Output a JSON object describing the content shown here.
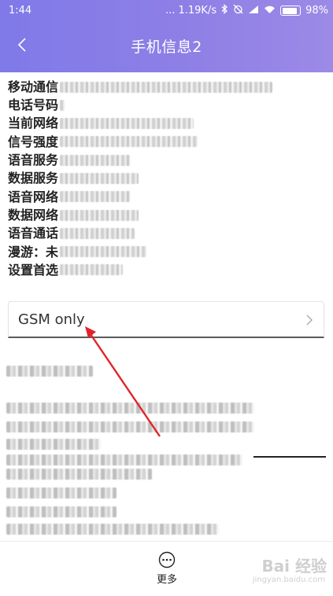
{
  "status_bar": {
    "time": "1:44",
    "network_speed": "... 1.19K/s",
    "battery": "98%"
  },
  "header": {
    "title": "手机信息2"
  },
  "info_rows": [
    {
      "label": "移动通信",
      "blur_width": 270
    },
    {
      "label": "电话号码",
      "blur_width": 6
    },
    {
      "label": "当前网络",
      "blur_width": 170
    },
    {
      "label": "信号强度",
      "blur_width": 175
    },
    {
      "label": "语音服务",
      "blur_width": 90
    },
    {
      "label": "数据服务",
      "blur_width": 100
    },
    {
      "label": "语音网络",
      "blur_width": 90
    },
    {
      "label": "数据网络",
      "blur_width": 100
    },
    {
      "label": "语音通话",
      "blur_width": 95
    },
    {
      "label": "漫游：未",
      "blur_width": 110
    },
    {
      "label": "设置首选",
      "blur_width": 80
    }
  ],
  "preferred_network": {
    "value": "GSM only"
  },
  "bottom_bar": {
    "more_label": "更多"
  },
  "watermark": {
    "text": "Bai 经验",
    "sub": "jingyan.baidu.com"
  },
  "colors": {
    "header_gradient_start": "#7f7ae8",
    "header_gradient_end": "#9c8ae6",
    "annotation_arrow": "#e0252a"
  }
}
